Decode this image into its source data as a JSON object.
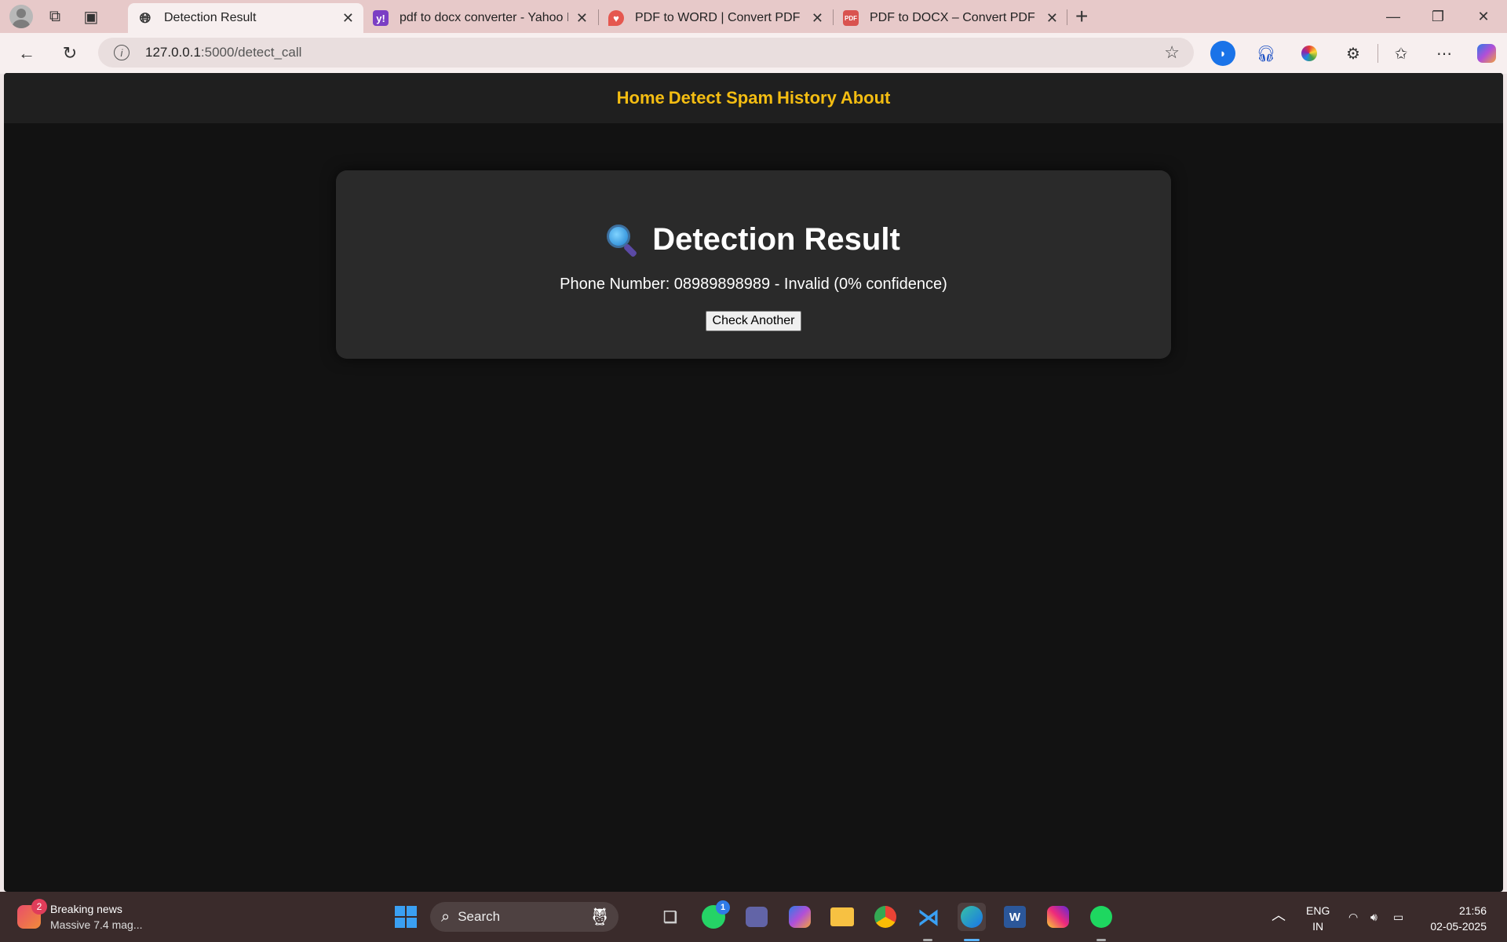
{
  "browser": {
    "tabs": [
      {
        "title": "Detection Result",
        "favicon": "globe-icon",
        "active": true
      },
      {
        "title": "pdf to docx converter - Yahoo India",
        "favicon": "yahoo-icon",
        "active": false
      },
      {
        "title": "PDF to WORD | Convert PDF to Word",
        "favicon": "ilovepdf-icon",
        "active": false
      },
      {
        "title": "PDF to DOCX – Convert PDF to DOCX",
        "favicon": "pdf-docx-icon",
        "active": false
      }
    ],
    "url_host": "127.0.0.1",
    "url_path": ":5000/detect_call"
  },
  "site_nav": {
    "items": [
      "Home",
      "Detect Spam",
      "History",
      "About"
    ],
    "color": "#f4bd12"
  },
  "result_card": {
    "title": "Detection Result",
    "icon": "magnifying-glass-icon",
    "result_text": "Phone Number: 08989898989 - Invalid (0% confidence)",
    "button_label": "Check Another"
  },
  "taskbar": {
    "news_title": "Breaking news",
    "news_subtitle": "Massive 7.4 mag...",
    "news_badge": "2",
    "search_label": "Search",
    "whatsapp_badge": "1",
    "lang_line1": "ENG",
    "lang_line2": "IN",
    "time": "21:56",
    "date": "02-05-2025"
  }
}
